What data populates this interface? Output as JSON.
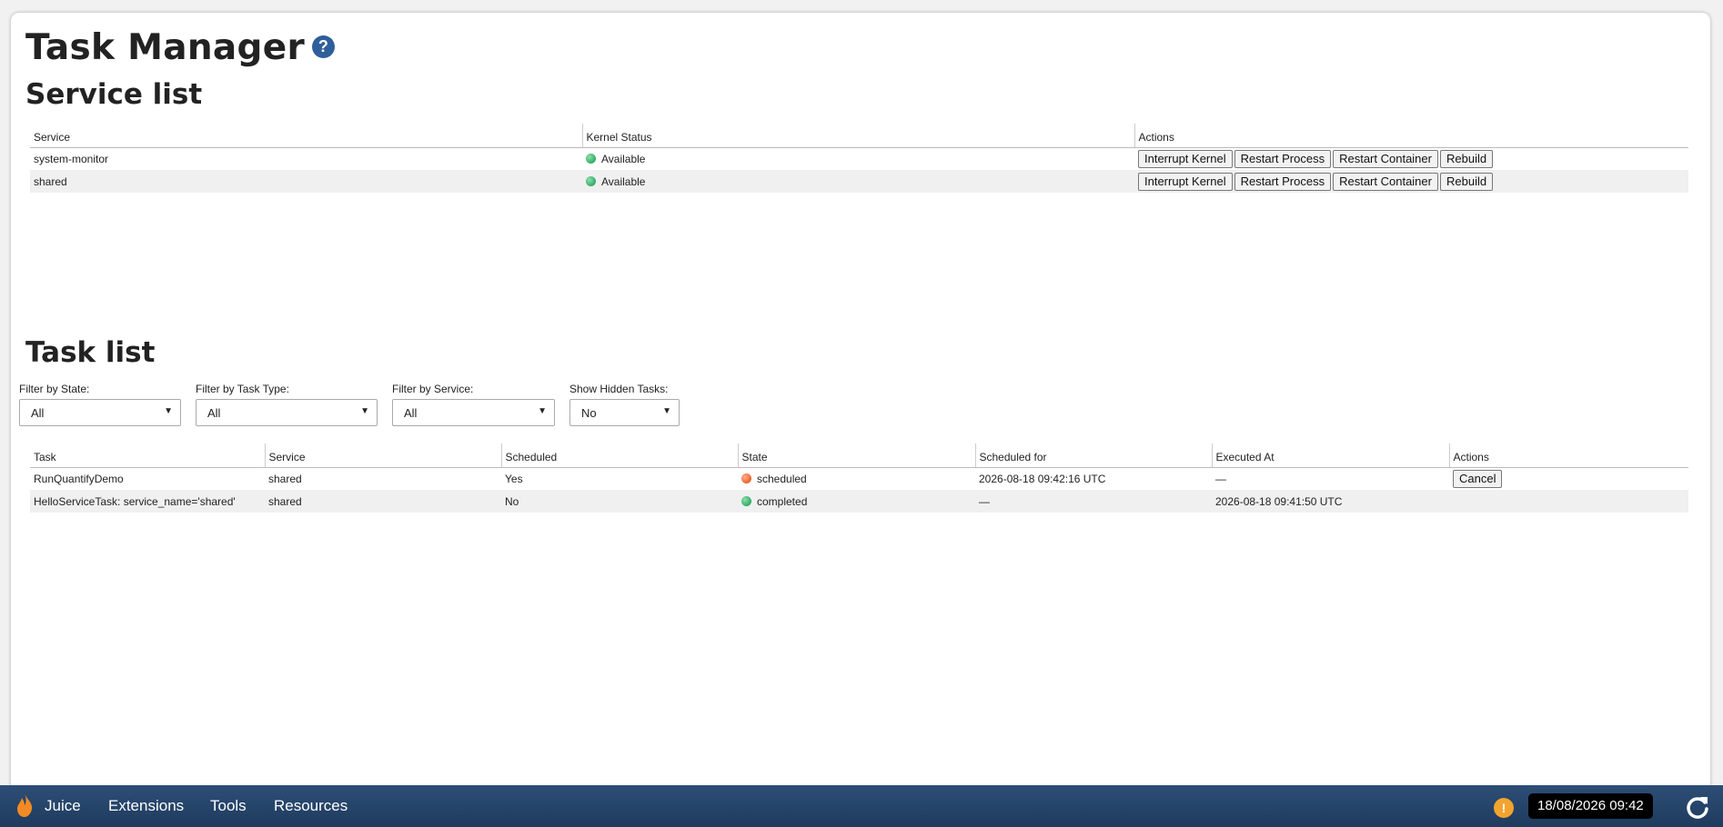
{
  "page_title": "Task Manager",
  "help_icon_label": "?",
  "services": {
    "title": "Service list",
    "columns": [
      "Service",
      "Kernel Status",
      "Actions"
    ],
    "rows": [
      {
        "service": "system-monitor",
        "status": "Available"
      },
      {
        "service": "shared",
        "status": "Available"
      }
    ],
    "actions": [
      "Interrupt Kernel",
      "Restart Process",
      "Restart Container",
      "Rebuild"
    ]
  },
  "tasks": {
    "title": "Task list",
    "filters": [
      {
        "label": "Filter by State:",
        "value": "All"
      },
      {
        "label": "Filter by Task Type:",
        "value": "All"
      },
      {
        "label": "Filter by Service:",
        "value": "All"
      },
      {
        "label": "Show Hidden Tasks:",
        "value": "No"
      }
    ],
    "columns": [
      "Task",
      "Service",
      "Scheduled",
      "State",
      "Scheduled for",
      "Executed At",
      "Actions"
    ],
    "rows": [
      {
        "task": "RunQuantifyDemo",
        "service": "shared",
        "scheduled": "Yes",
        "state": "scheduled",
        "scheduled_for": "2026-08-18 09:42:16 UTC",
        "executed_at": "—",
        "action": "Cancel"
      },
      {
        "task": "HelloServiceTask: service_name='shared'",
        "service": "shared",
        "scheduled": "No",
        "state": "completed",
        "scheduled_for": "—",
        "executed_at": "2026-08-18 09:41:50 UTC",
        "action": ""
      }
    ]
  },
  "colors": {
    "available": "#3cb371",
    "scheduled": "#f26b3a",
    "completed": "#3cb371",
    "taskbar": "#24456b",
    "help": "#2f5f9a",
    "warning": "#f3a42f"
  },
  "taskbar": {
    "menu": [
      "Juice",
      "Extensions",
      "Tools",
      "Resources"
    ],
    "warning_label": "!",
    "clock": "18/08/2026 09:42"
  }
}
